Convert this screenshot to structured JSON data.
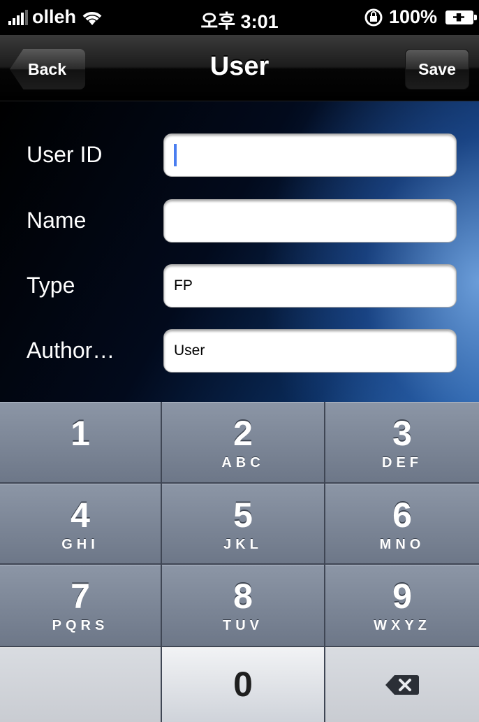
{
  "status_bar": {
    "carrier": "olleh",
    "time": "오후 3:01",
    "battery": "100%"
  },
  "nav": {
    "title": "User",
    "back_label": "Back",
    "save_label": "Save"
  },
  "form": {
    "fields": [
      {
        "label": "User ID",
        "value": ""
      },
      {
        "label": "Name",
        "value": ""
      },
      {
        "label": "Type",
        "value": "FP"
      },
      {
        "label": "Author…",
        "value": "User"
      }
    ]
  },
  "keypad": {
    "keys": [
      {
        "digit": "1",
        "letters": ""
      },
      {
        "digit": "2",
        "letters": "ABC"
      },
      {
        "digit": "3",
        "letters": "DEF"
      },
      {
        "digit": "4",
        "letters": "GHI"
      },
      {
        "digit": "5",
        "letters": "JKL"
      },
      {
        "digit": "6",
        "letters": "MNO"
      },
      {
        "digit": "7",
        "letters": "PQRS"
      },
      {
        "digit": "8",
        "letters": "TUV"
      },
      {
        "digit": "9",
        "letters": "WXYZ"
      },
      {
        "digit": "0",
        "letters": ""
      }
    ],
    "delete_icon": "backspace-icon"
  }
}
